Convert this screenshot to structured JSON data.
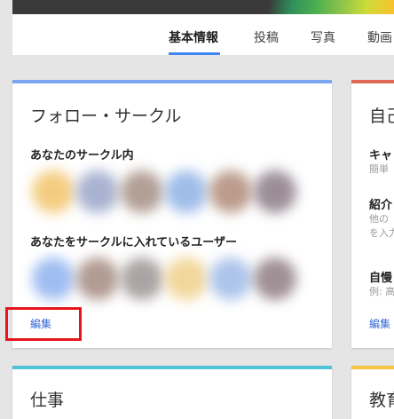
{
  "tabs": [
    {
      "label": "基本情報",
      "active": true
    },
    {
      "label": "投稿",
      "active": false
    },
    {
      "label": "写真",
      "active": false
    },
    {
      "label": "動画",
      "active": false
    }
  ],
  "follow_card": {
    "title": "フォロー・サークル",
    "section1_label": "あなたのサークル内",
    "section2_label": "あなたをサークルに入れているユーザー",
    "edit_label": "編集",
    "accent_color": "#7aa7ef"
  },
  "about_card": {
    "title": "自己",
    "field1_label": "キャ",
    "field1_hint": "簡単",
    "field2_label": "紹介",
    "field2_hint_line1": "他の",
    "field2_hint_line2": "を入力",
    "field3_label": "自慢",
    "field3_hint": "例: 高",
    "edit_label": "編集",
    "accent_color": "#e06a56"
  },
  "work_card": {
    "title": "仕事",
    "accent_color": "#4fc3d4"
  },
  "education_card": {
    "title": "教育",
    "accent_color": "#f6c343"
  },
  "colors": {
    "link": "#3367d6",
    "highlight": "#e8141c",
    "tab_underline": "#4285f4"
  }
}
